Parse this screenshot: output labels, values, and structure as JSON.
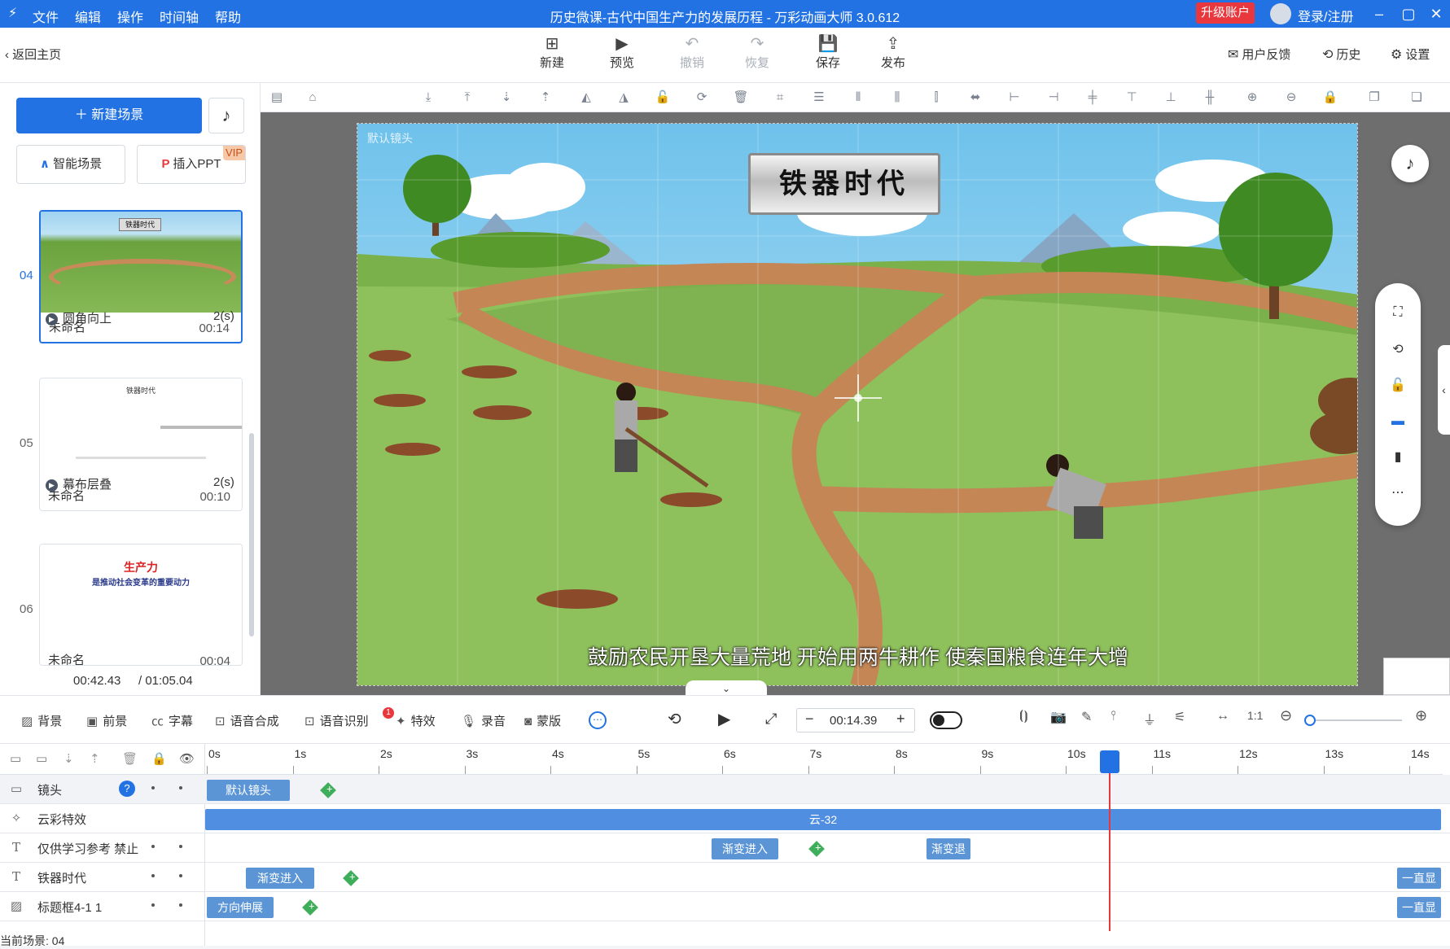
{
  "app": {
    "menu": [
      "文件",
      "编辑",
      "操作",
      "时间轴",
      "帮助"
    ],
    "title": "历史微课-古代中国生产力的发展历程 - 万彩动画大师 3.0.612",
    "upgrade": "升级账户",
    "login": "登录/注册"
  },
  "toolbar": {
    "back": "返回主页",
    "buttons": [
      {
        "label": "新建",
        "icon": "plus-square-icon"
      },
      {
        "label": "预览",
        "icon": "play-icon"
      },
      {
        "label": "撤销",
        "icon": "undo-icon"
      },
      {
        "label": "恢复",
        "icon": "redo-icon"
      },
      {
        "label": "保存",
        "icon": "save-icon"
      },
      {
        "label": "发布",
        "icon": "publish-icon"
      }
    ],
    "right": [
      "用户反馈",
      "历史",
      "设置"
    ]
  },
  "left": {
    "new_scene": "新建场景",
    "smart_scene": "智能场景",
    "insert_ppt": "插入PPT",
    "vip": "VIP",
    "scenes": [
      {
        "num": "04",
        "name": "未命名",
        "duration": "00:14",
        "thumb_title": "铁器时代",
        "active": true
      },
      {
        "num": "05",
        "name": "未命名",
        "duration": "00:10",
        "thumb_title": "铁器时代",
        "active": false
      },
      {
        "num": "06",
        "name": "未命名",
        "duration": "00:04",
        "thumb_title": "生产力",
        "thumb_sub": "是推动社会变革的重要动力",
        "active": false
      }
    ],
    "transitions": [
      {
        "name": "圆角向上",
        "duration": "2(s)"
      },
      {
        "name": "幕布层叠",
        "duration": "2(s)"
      }
    ],
    "time_current": "00:42.43",
    "time_total": "/ 01:05.04"
  },
  "stage": {
    "camera_label": "默认镜头",
    "banner": "铁器时代",
    "subtitle": "鼓励农民开垦大量荒地 开始用两牛耕作 使秦国粮食连年大增"
  },
  "bottom": {
    "tools": [
      "背景",
      "前景",
      "字幕",
      "语音合成",
      "语音识别",
      "特效",
      "录音",
      "蒙版"
    ],
    "badge": "1",
    "time": "00:14.39"
  },
  "timeline": {
    "ticks": [
      "0s",
      "1s",
      "2s",
      "3s",
      "4s",
      "5s",
      "6s",
      "7s",
      "8s",
      "9s",
      "10s",
      "11s",
      "12s",
      "13s",
      "14s"
    ],
    "tracks": [
      {
        "label": "镜头",
        "clips": [
          "默认镜头"
        ]
      },
      {
        "label": "云彩特效",
        "clips": [
          "云-32"
        ]
      },
      {
        "label": "仅供学习参考 禁止",
        "clips": [
          "渐变进入",
          "渐变退"
        ]
      },
      {
        "label": "铁器时代",
        "clips": [
          "渐变进入",
          "一直显"
        ]
      },
      {
        "label": "标题框4-1 1",
        "clips": [
          "方向伸展",
          "一直显"
        ]
      }
    ],
    "status": "当前场景: 04"
  },
  "colors": {
    "accent": "#2272e4",
    "clip": "#5b95d6",
    "keyframe": "#3fae5a",
    "playhead": "#e8383d",
    "upgrade": "#e8383d"
  }
}
